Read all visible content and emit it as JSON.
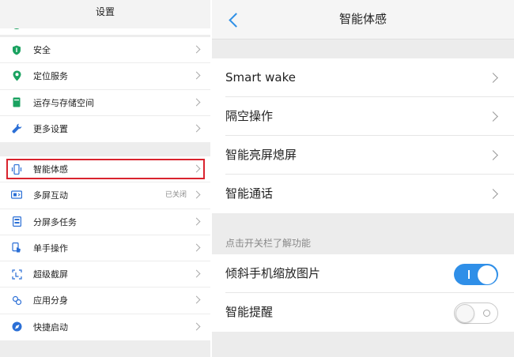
{
  "left": {
    "title": "设置",
    "group1": [
      {
        "label": "安全",
        "icon": "shield-icon",
        "color": "#1aa260"
      },
      {
        "label": "定位服务",
        "icon": "location-pin-icon",
        "color": "#1aa260"
      },
      {
        "label": "运存与存储空间",
        "icon": "storage-icon",
        "color": "#1aa260"
      },
      {
        "label": "更多设置",
        "icon": "wrench-icon",
        "color": "#2b6fd6"
      }
    ],
    "group2": [
      {
        "label": "智能体感",
        "icon": "phone-motion-icon",
        "value": ""
      },
      {
        "label": "多屏互动",
        "icon": "screen-share-icon",
        "value": "已关闭"
      },
      {
        "label": "分屏多任务",
        "icon": "split-screen-icon",
        "value": ""
      },
      {
        "label": "单手操作",
        "icon": "one-hand-icon",
        "value": ""
      },
      {
        "label": "超级截屏",
        "icon": "screenshot-icon",
        "value": ""
      },
      {
        "label": "应用分身",
        "icon": "app-clone-icon",
        "value": ""
      },
      {
        "label": "快捷启动",
        "icon": "quick-launch-icon",
        "value": ""
      }
    ]
  },
  "right": {
    "title": "智能体感",
    "items": [
      {
        "label": "Smart wake"
      },
      {
        "label": "隔空操作"
      },
      {
        "label": "智能亮屏熄屏"
      },
      {
        "label": "智能通话"
      }
    ],
    "section_hint": "点击开关栏了解功能",
    "toggles": [
      {
        "label": "倾斜手机缩放图片",
        "state": "on"
      },
      {
        "label": "智能提醒",
        "state": "off"
      }
    ]
  },
  "colors": {
    "accent": "#2f8fe8",
    "highlight": "#d9232e"
  }
}
